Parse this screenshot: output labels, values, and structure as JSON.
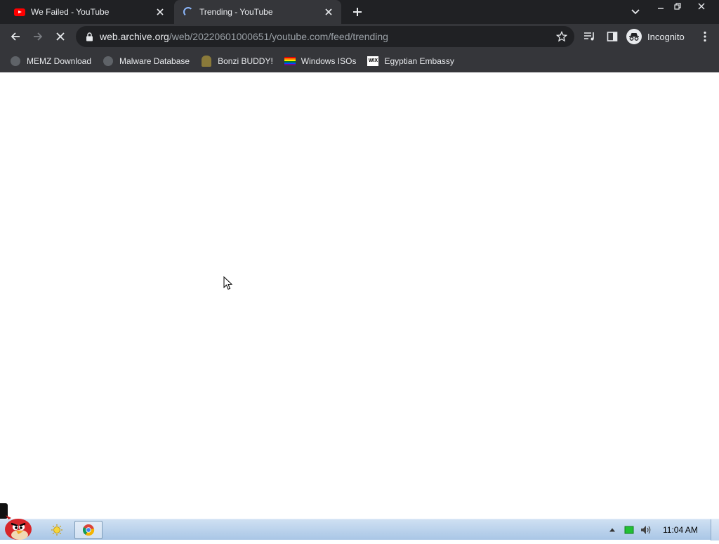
{
  "tabs": [
    {
      "title": "We Failed - YouTube",
      "state": "inactive",
      "icon": "youtube-icon"
    },
    {
      "title": "Trending - YouTube",
      "state": "active-loading",
      "icon": "loading-spinner-icon"
    }
  ],
  "omnibox": {
    "host": "web.archive.org",
    "path": "/web/20220601000651/youtube.com/feed/trending"
  },
  "profile": {
    "label": "Incognito"
  },
  "bookmarks": [
    {
      "label": "MEMZ Download",
      "icon": "globe-icon"
    },
    {
      "label": "Malware Database",
      "icon": "globe-icon"
    },
    {
      "label": "Bonzi BUDDY!",
      "icon": "bonzi-icon"
    },
    {
      "label": "Windows ISOs",
      "icon": "rainbow-flag-icon"
    },
    {
      "label": "Egyptian Embassy",
      "icon": "wix-icon"
    }
  ],
  "taskbar": {
    "clock": "11:04 AM"
  },
  "colors": {
    "chrome_dark": "#202124",
    "toolbar": "#35363a",
    "accent_blue": "#8ab4f8",
    "taskbar_blue": "#a9c6e6"
  }
}
